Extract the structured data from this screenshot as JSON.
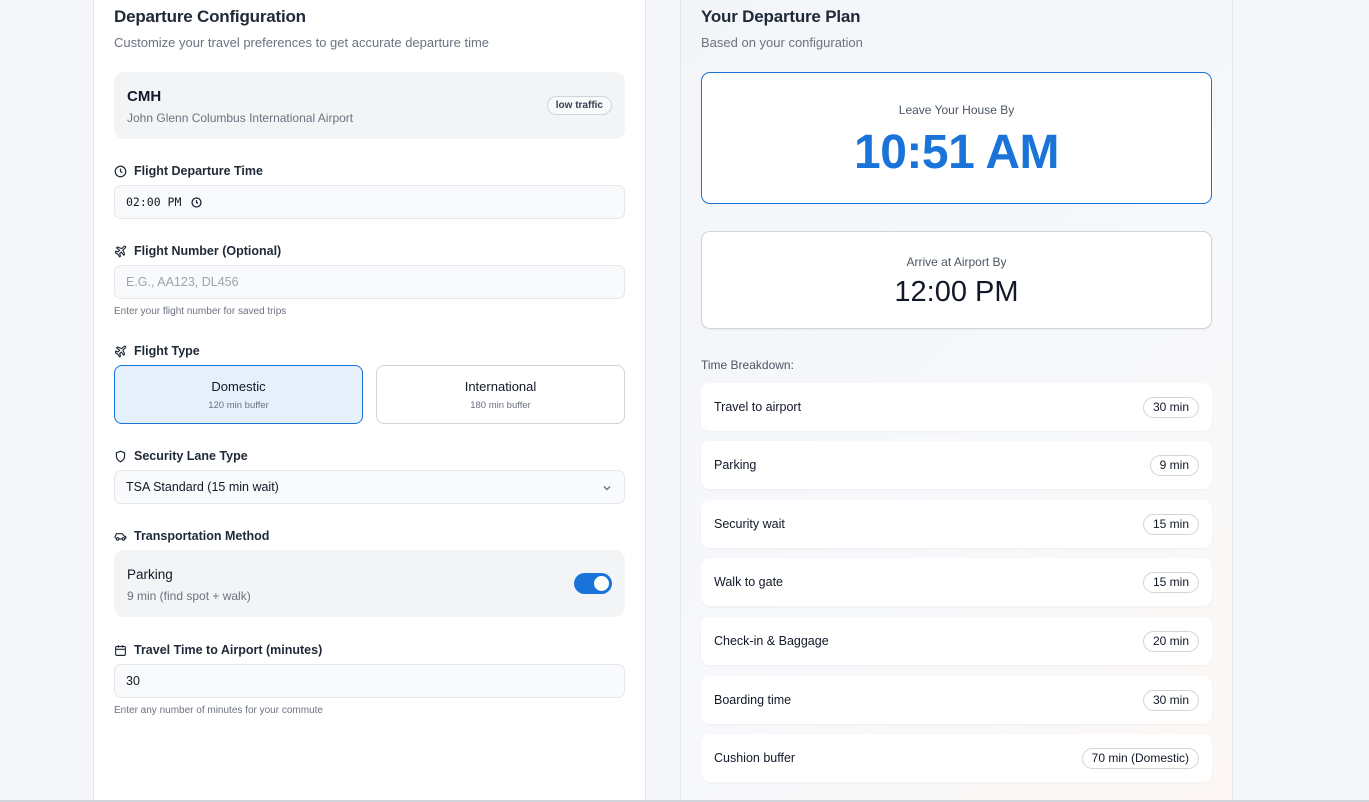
{
  "left": {
    "title": "Departure Configuration",
    "subtitle": "Customize your travel preferences to get accurate departure time",
    "airport": {
      "code": "CMH",
      "name": "John Glenn Columbus International Airport",
      "traffic": "low traffic"
    },
    "departure_time": {
      "label": "Flight Departure Time",
      "value": "02:00 PM"
    },
    "flight_number": {
      "label": "Flight Number (Optional)",
      "placeholder": "E.G., AA123, DL456",
      "hint": "Enter your flight number for saved trips"
    },
    "flight_type": {
      "label": "Flight Type",
      "options": [
        {
          "title": "Domestic",
          "sub": "120 min buffer"
        },
        {
          "title": "International",
          "sub": "180 min buffer"
        }
      ]
    },
    "security": {
      "label": "Security Lane Type",
      "value": "TSA Standard (15 min wait)"
    },
    "transport": {
      "label": "Transportation Method",
      "title": "Parking",
      "sub": "9 min (find spot + walk)"
    },
    "travel_time": {
      "label": "Travel Time to Airport (minutes)",
      "value": "30",
      "hint": "Enter any number of minutes for your commute"
    }
  },
  "right": {
    "title": "Your Departure Plan",
    "subtitle": "Based on your configuration",
    "leave_label": "Leave Your House By",
    "leave_time": "10:51 AM",
    "arrive_label": "Arrive at Airport By",
    "arrive_time": "12:00 PM",
    "breakdown_label": "Time Breakdown:",
    "breakdown": [
      {
        "name": "Travel to airport",
        "value": "30 min"
      },
      {
        "name": "Parking",
        "value": "9 min"
      },
      {
        "name": "Security wait",
        "value": "15 min"
      },
      {
        "name": "Walk to gate",
        "value": "15 min"
      },
      {
        "name": "Check-in & Baggage",
        "value": "20 min"
      },
      {
        "name": "Boarding time",
        "value": "30 min"
      },
      {
        "name": "Cushion buffer",
        "value": "70 min (Domestic)"
      }
    ]
  },
  "colors": {
    "accent": "#1a73d9"
  }
}
